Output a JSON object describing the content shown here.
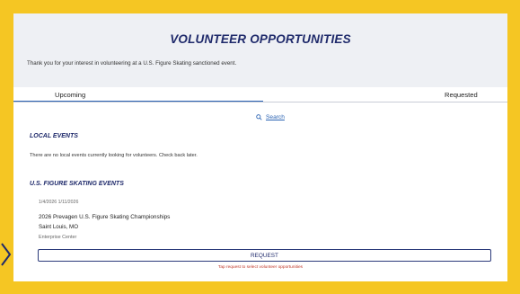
{
  "header": {
    "title": "VOLUNTEER OPPORTUNITIES",
    "intro": "Thank you for your interest in volunteering at a U.S. Figure Skating sanctioned event."
  },
  "tabs": [
    {
      "label": "Upcoming",
      "selected": true
    },
    {
      "label": "Requested",
      "selected": false
    }
  ],
  "search": {
    "label": "Search",
    "icon": "search-icon"
  },
  "local_events": {
    "title": "LOCAL EVENTS",
    "message": "There are no local events currently looking for volunteers. Check back later."
  },
  "usfs_events": {
    "title": "U.S. FIGURE SKATING EVENTS",
    "items": [
      {
        "dates": "1/4/2026 1/11/2026",
        "name": "2026 Prevagen U.S. Figure Skating Championships",
        "location": "Saint Louis, MO",
        "venue": "Enterprise Center",
        "button_label": "REQUEST",
        "hint": "Tap request to select volunteer opportunities"
      }
    ]
  },
  "colors": {
    "border": "#f5c623",
    "header_bg": "#eef0f4",
    "title": "#1f2a6b",
    "link": "#2b63b3",
    "hint": "#c0392b"
  }
}
